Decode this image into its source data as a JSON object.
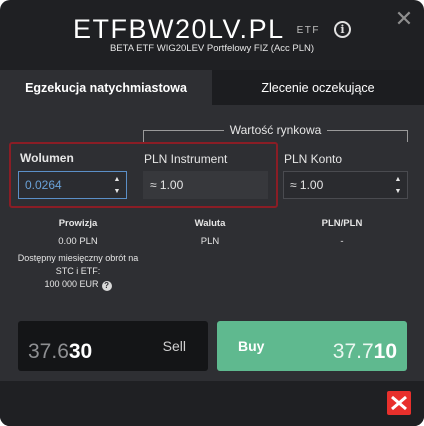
{
  "header": {
    "symbol": "ETFBW20LV.PL",
    "tag": "ETF",
    "subtitle": "BETA ETF WIG20LEV Portfelowy FIZ (Acc PLN)"
  },
  "tabs": [
    {
      "label": "Egzekucja natychmiastowa",
      "active": true
    },
    {
      "label": "Zlecenie oczekujące",
      "active": false
    }
  ],
  "form": {
    "market_value_label": "Wartość rynkowa",
    "volume": {
      "label": "Wolumen",
      "value": "0.0264"
    },
    "instrument": {
      "label": "PLN Instrument",
      "value": "≈ 1.00"
    },
    "account": {
      "label": "PLN Konto",
      "value": "≈ 1.00"
    }
  },
  "info": {
    "commission": {
      "label": "Prowizja",
      "value": "0.00 PLN",
      "note_line1": "Dostępny miesięczny obrót na",
      "note_line2": "STC i ETF:",
      "note_line3": "100 000 EUR"
    },
    "currency": {
      "label": "Waluta",
      "value": "PLN"
    },
    "rate": {
      "label": "PLN/PLN",
      "value": "-"
    }
  },
  "trade": {
    "sell": {
      "label": "Sell",
      "price_main": "37.6",
      "price_big": "30"
    },
    "buy": {
      "label": "Buy",
      "price_main": "37.7",
      "price_big": "10"
    }
  },
  "colors": {
    "buy": "#5fb98f",
    "brand": "#e8302c",
    "highlight": "#8a1d25"
  }
}
